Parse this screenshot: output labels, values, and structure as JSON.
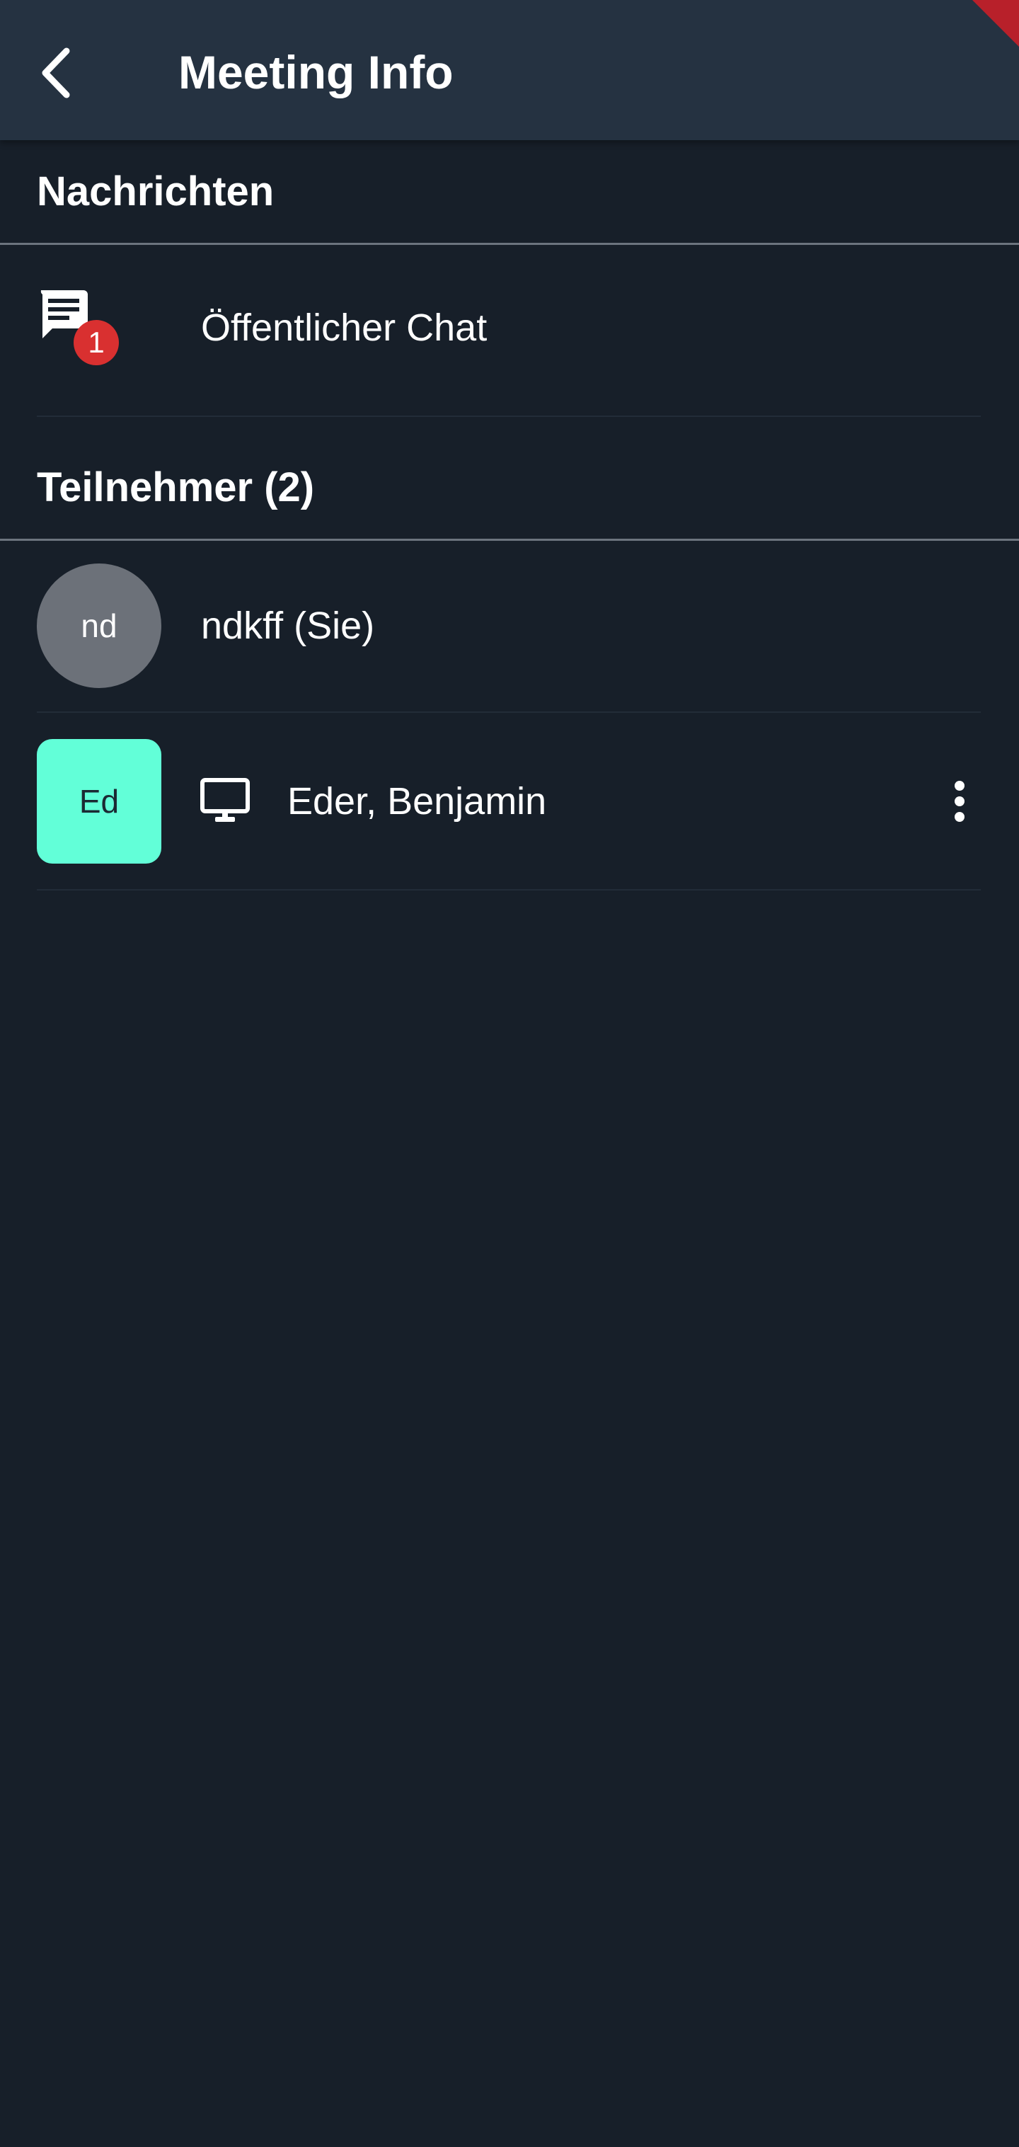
{
  "header": {
    "title": "Meeting Info",
    "back_icon": "chevron-left-icon"
  },
  "messages_section": {
    "title": "Nachrichten",
    "items": [
      {
        "label": "Öffentlicher Chat",
        "icon": "chat-icon",
        "unread_count": "1",
        "badge_color": "#d93030"
      }
    ]
  },
  "participants_section": {
    "title": "Teilnehmer (2)",
    "items": [
      {
        "initials": "nd",
        "name": "ndkff (Sie)",
        "avatar_color": "#6c7179",
        "avatar_shape": "circle"
      },
      {
        "initials": "Ed",
        "name": "Eder, Benjamin",
        "avatar_color": "#62ffd8",
        "avatar_shape": "rounded-square",
        "status_icon": "desktop-icon",
        "menu_icon": "more-vertical-icon"
      }
    ]
  },
  "colors": {
    "background": "#171f29",
    "appbar": "#253241",
    "text": "#ffffff"
  }
}
